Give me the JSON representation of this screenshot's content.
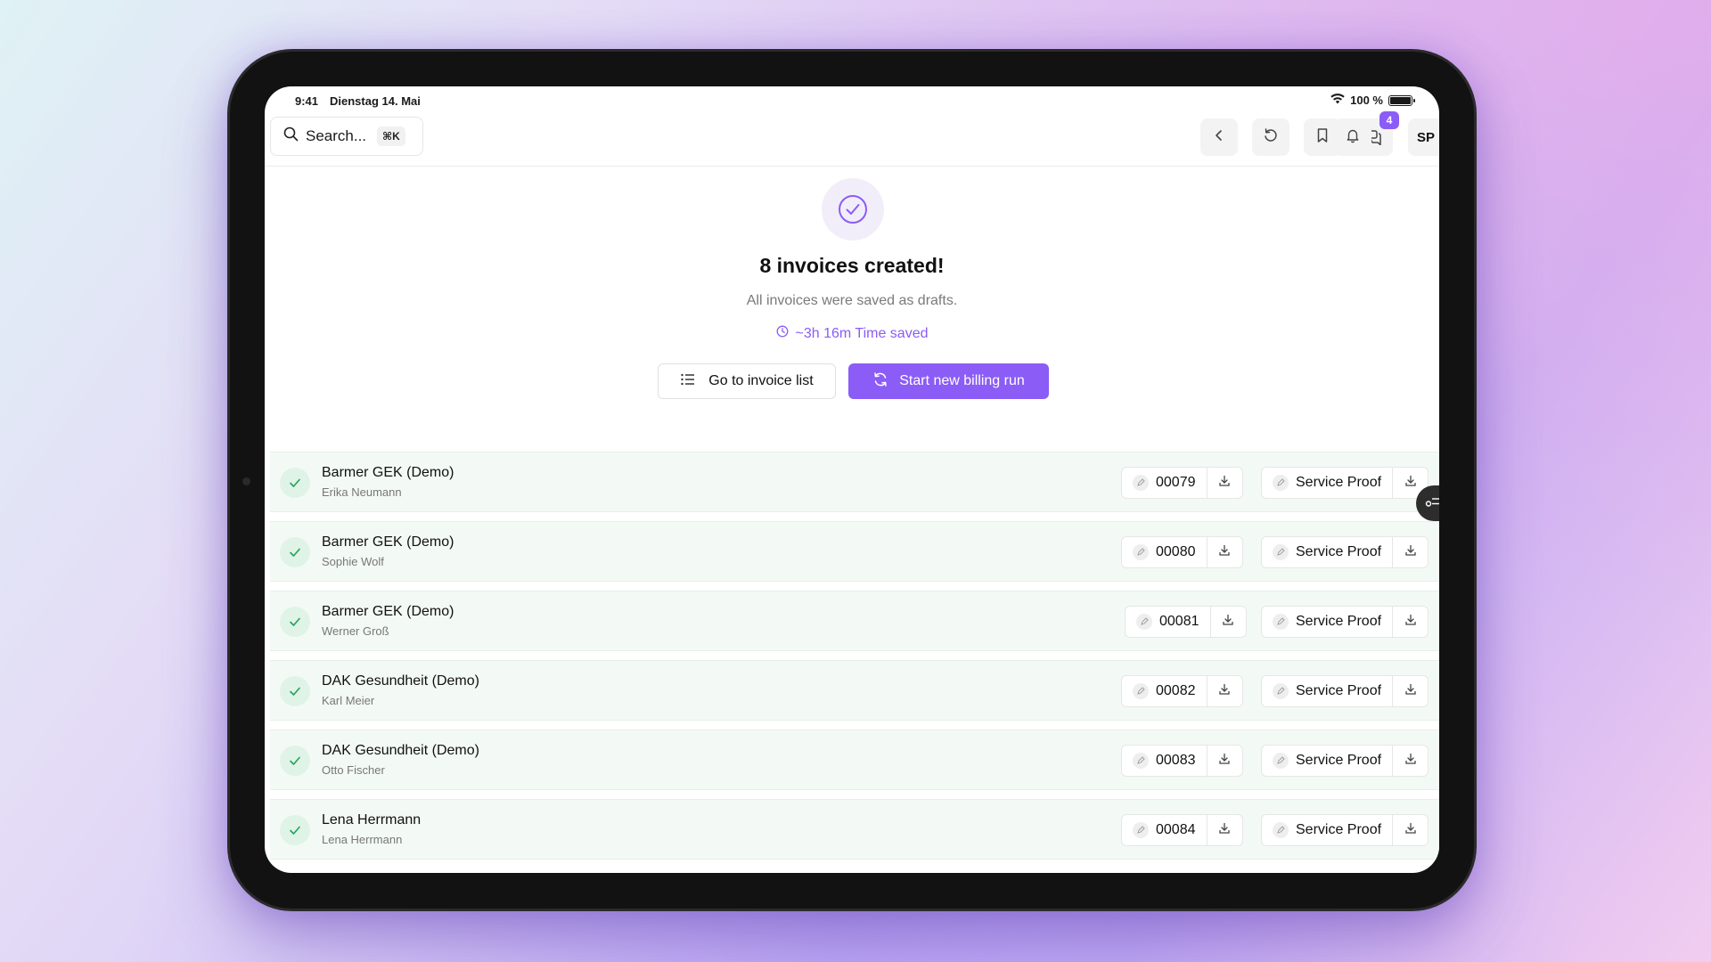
{
  "status_bar": {
    "time": "9:41",
    "date": "Dienstag 14. Mai",
    "battery": "100 %"
  },
  "topbar": {
    "search_label": "Search...",
    "search_shortcut": "⌘K",
    "notification_count": "4",
    "avatar_initials": "SP"
  },
  "success": {
    "title": "8 invoices created!",
    "subtitle": "All invoices were saved as drafts.",
    "time_saved": "~3h 16m Time saved"
  },
  "actions": {
    "go_to_list": "Go to invoice list",
    "new_run": "Start new billing run"
  },
  "invoices": [
    {
      "insurer": "Barmer GEK (Demo)",
      "patient": "Erika Neumann",
      "number": "00079",
      "proof": "Service Proof"
    },
    {
      "insurer": "Barmer GEK (Demo)",
      "patient": "Sophie Wolf",
      "number": "00080",
      "proof": "Service Proof"
    },
    {
      "insurer": "Barmer GEK (Demo)",
      "patient": "Werner Groß",
      "number": "00081",
      "proof": "Service Proof"
    },
    {
      "insurer": "DAK Gesundheit (Demo)",
      "patient": "Karl Meier",
      "number": "00082",
      "proof": "Service Proof"
    },
    {
      "insurer": "DAK Gesundheit (Demo)",
      "patient": "Otto Fischer",
      "number": "00083",
      "proof": "Service Proof"
    },
    {
      "insurer": "Lena Herrmann",
      "patient": "Lena Herrmann",
      "number": "00084",
      "proof": "Service Proof"
    }
  ],
  "colors": {
    "accent": "#8b5cf6",
    "success_bg": "#f3faf6",
    "success_check": "#22a35a"
  }
}
